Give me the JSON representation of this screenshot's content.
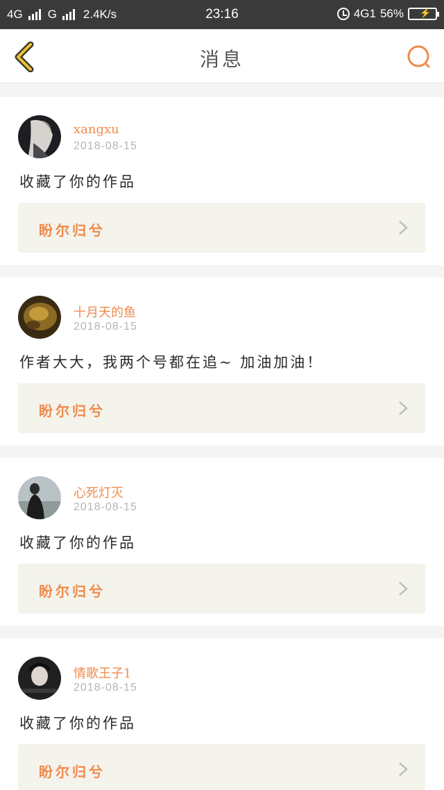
{
  "status_bar": {
    "left_network_1": "4G",
    "left_network_2": "G",
    "speed": "2.4K/s",
    "time": "23:16",
    "right_network": "4G1",
    "battery_percent": "56%",
    "battery_level": 0.56
  },
  "header": {
    "title": "消息",
    "back_icon": "chevron-left-icon",
    "search_icon": "search-icon",
    "accent_color": "#f08a4b",
    "back_color": "#f1c232"
  },
  "messages": [
    {
      "user": "xangxu",
      "date": "2018-08-15",
      "content": "收藏了你的作品",
      "work_title": "盼尔归兮"
    },
    {
      "user": "十月天的鱼",
      "date": "2018-08-15",
      "content": "作者大大，我两个号都在追~ 加油加油！",
      "work_title": "盼尔归兮"
    },
    {
      "user": "心死灯灭",
      "date": "2018-08-15",
      "content": "收藏了你的作品",
      "work_title": "盼尔归兮"
    },
    {
      "user": "情歌王子1",
      "date": "2018-08-15",
      "content": "收藏了你的作品",
      "work_title": "盼尔归兮"
    }
  ]
}
